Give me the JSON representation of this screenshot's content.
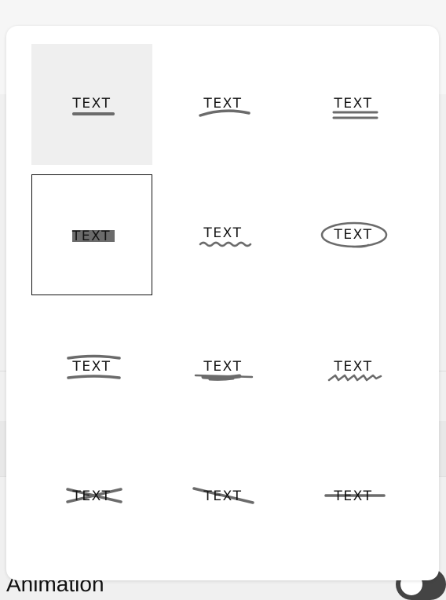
{
  "background": {
    "animation_label": "Animation"
  },
  "picker": {
    "items": [
      {
        "id": "underline",
        "label": "TEXT",
        "icon": "underline-icon"
      },
      {
        "id": "curved-underline",
        "label": "TEXT",
        "icon": "curved-underline-icon"
      },
      {
        "id": "double-underline",
        "label": "TEXT",
        "icon": "double-underline-icon"
      },
      {
        "id": "highlight",
        "label": "TEXT",
        "icon": "highlight-icon"
      },
      {
        "id": "wavy-underline",
        "label": "TEXT",
        "icon": "wavy-underline-icon"
      },
      {
        "id": "circle",
        "label": "TEXT",
        "icon": "circle-icon"
      },
      {
        "id": "bracket",
        "label": "TEXT",
        "icon": "bracket-icon"
      },
      {
        "id": "marker-underline",
        "label": "TEXT",
        "icon": "marker-underline-icon"
      },
      {
        "id": "zigzag-underline",
        "label": "TEXT",
        "icon": "zigzag-underline-icon"
      },
      {
        "id": "cross-out",
        "label": "TEXT",
        "icon": "cross-out-icon"
      },
      {
        "id": "slash",
        "label": "TEXT",
        "icon": "slash-icon"
      },
      {
        "id": "strike-through",
        "label": "TEXT",
        "icon": "strike-through-icon"
      }
    ]
  },
  "colors": {
    "mark": "#6b6b6b",
    "selected_fill": "#efefef",
    "text": "#111111"
  }
}
